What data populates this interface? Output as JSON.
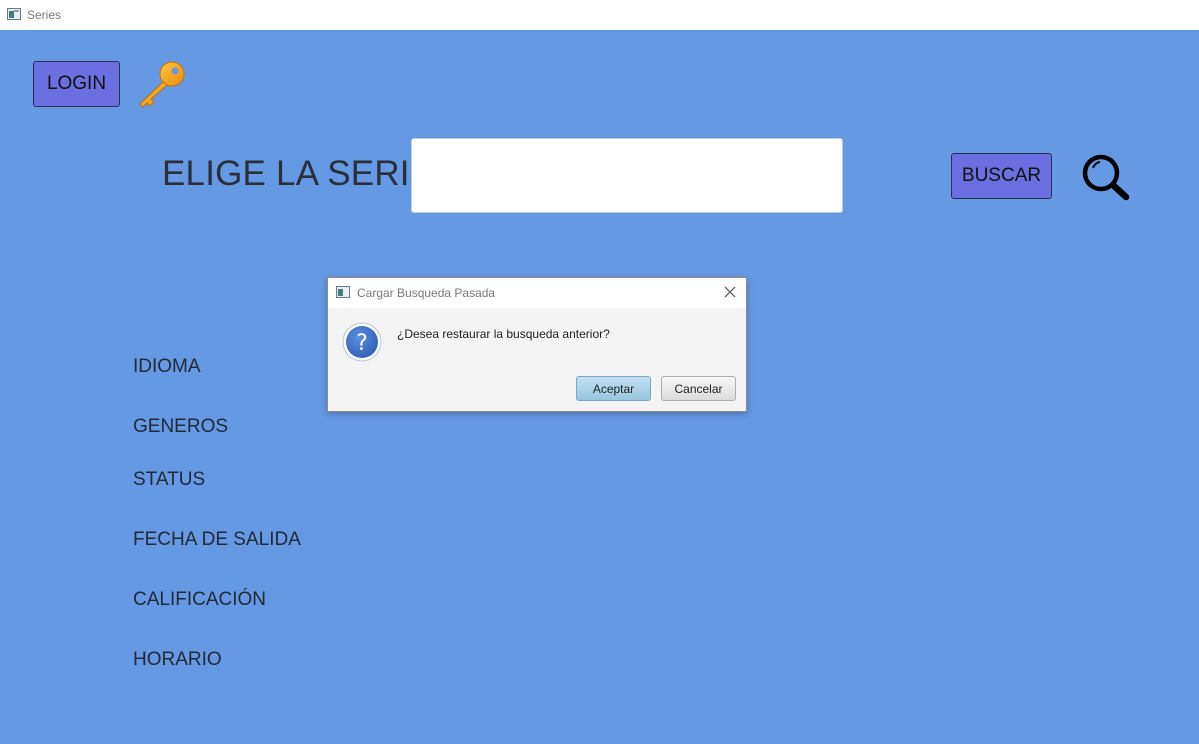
{
  "window": {
    "title": "Series"
  },
  "header": {
    "login_label": "LOGIN",
    "key_icon": "key-icon"
  },
  "search": {
    "prompt_label": "ELIGE LA SERIE:",
    "input_value": "",
    "button_label": "BUSCAR",
    "icon": "search-icon"
  },
  "filters": [
    {
      "label": "IDIOMA"
    },
    {
      "label": "GENEROS"
    },
    {
      "label": "STATUS"
    },
    {
      "label": "FECHA DE SALIDA"
    },
    {
      "label": "CALIFICACIÓN"
    },
    {
      "label": "HORARIO"
    }
  ],
  "dialog": {
    "title": "Cargar Busqueda Pasada",
    "message": "¿Desea restaurar la busqueda anterior?",
    "accept_label": "Aceptar",
    "cancel_label": "Cancelar",
    "icon": "question-icon"
  },
  "colors": {
    "background": "#6699e3",
    "button": "#6b6fe0",
    "accept_button": "#a9d2ea",
    "question_icon": "#3e6fc6"
  }
}
